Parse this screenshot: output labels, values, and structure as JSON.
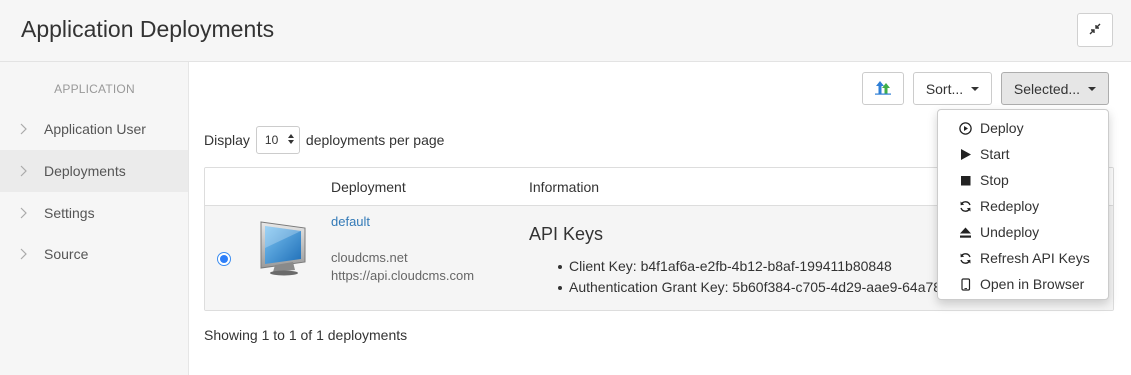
{
  "header": {
    "title": "Application Deployments",
    "collapse_icon": "compress-icon"
  },
  "sidebar": {
    "heading": "APPLICATION",
    "items": [
      {
        "label": "Application User",
        "active": false
      },
      {
        "label": "Deployments",
        "active": true
      },
      {
        "label": "Settings",
        "active": false
      },
      {
        "label": "Source",
        "active": false
      }
    ]
  },
  "toolbar": {
    "upload_icon": "upload-arrows-icon",
    "sort_label": "Sort...",
    "selected_label": "Selected..."
  },
  "pagination": {
    "display_label": "Display",
    "page_size": "10",
    "per_page_label": "deployments per page",
    "showing_text": "Showing 1 to 1 of 1 deployments"
  },
  "table": {
    "columns": [
      "Deployment",
      "Information"
    ],
    "rows": [
      {
        "selected": true,
        "name": "default",
        "host": "cloudcms.net",
        "url": "https://api.cloudcms.com",
        "info_title": "API Keys",
        "keys": [
          "Client Key: b4f1af6a-e2fb-4b12-b8af-199411b80848",
          "Authentication Grant Key: 5b60f384-c705-4d29-aae9-64a78"
        ]
      }
    ]
  },
  "menu": {
    "items": [
      {
        "label": "Deploy",
        "icon": "play-circle-icon"
      },
      {
        "label": "Start",
        "icon": "play-icon"
      },
      {
        "label": "Stop",
        "icon": "stop-icon"
      },
      {
        "label": "Redeploy",
        "icon": "refresh-icon"
      },
      {
        "label": "Undeploy",
        "icon": "eject-icon"
      },
      {
        "label": "Refresh API Keys",
        "icon": "refresh-icon"
      },
      {
        "label": "Open in Browser",
        "icon": "phone-icon"
      }
    ]
  },
  "colors": {
    "accent": "#337ab7",
    "radio": "#2d7ff9",
    "sidebar_bg": "#f6f6f6"
  }
}
